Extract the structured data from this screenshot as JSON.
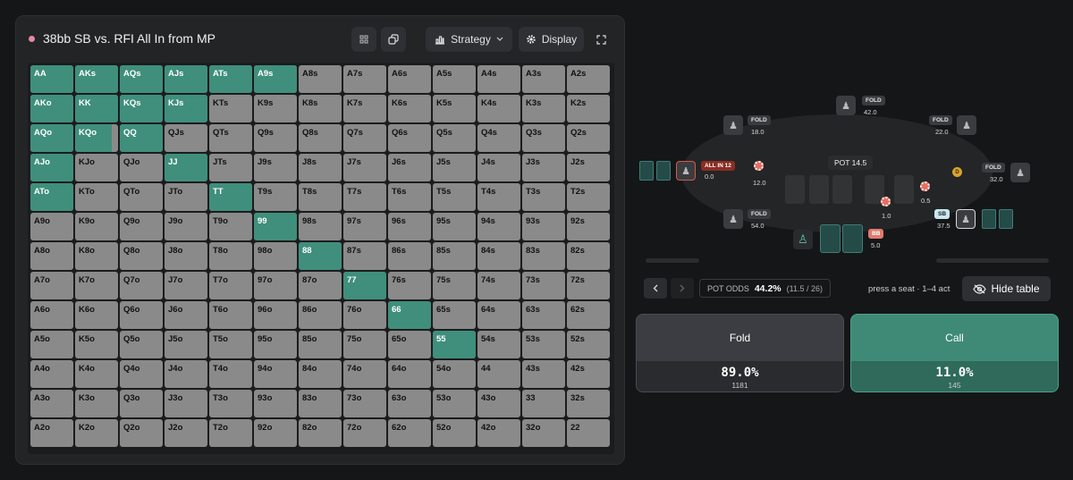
{
  "header": {
    "title": "38bb SB vs. RFI All In from MP",
    "strategy_label": "Strategy",
    "display_label": "Display",
    "status_color": "#e28aa0"
  },
  "colors": {
    "action_call": "#3f8f7c",
    "cell_fold": "#8a8a8a",
    "background": "#151617"
  },
  "range_grid": {
    "hands": [
      [
        "AA",
        "AKs",
        "AQs",
        "AJs",
        "ATs",
        "A9s",
        "A8s",
        "A7s",
        "A6s",
        "A5s",
        "A4s",
        "A3s",
        "A2s"
      ],
      [
        "AKo",
        "KK",
        "KQs",
        "KJs",
        "KTs",
        "K9s",
        "K8s",
        "K7s",
        "K6s",
        "K5s",
        "K4s",
        "K3s",
        "K2s"
      ],
      [
        "AQo",
        "KQo",
        "QQ",
        "QJs",
        "QTs",
        "Q9s",
        "Q8s",
        "Q7s",
        "Q6s",
        "Q5s",
        "Q4s",
        "Q3s",
        "Q2s"
      ],
      [
        "AJo",
        "KJo",
        "QJo",
        "JJ",
        "JTs",
        "J9s",
        "J8s",
        "J7s",
        "J6s",
        "J5s",
        "J4s",
        "J3s",
        "J2s"
      ],
      [
        "ATo",
        "KTo",
        "QTo",
        "JTo",
        "TT",
        "T9s",
        "T8s",
        "T7s",
        "T6s",
        "T5s",
        "T4s",
        "T3s",
        "T2s"
      ],
      [
        "A9o",
        "K9o",
        "Q9o",
        "J9o",
        "T9o",
        "99",
        "98s",
        "97s",
        "96s",
        "95s",
        "94s",
        "93s",
        "92s"
      ],
      [
        "A8o",
        "K8o",
        "Q8o",
        "J8o",
        "T8o",
        "98o",
        "88",
        "87s",
        "86s",
        "85s",
        "84s",
        "83s",
        "82s"
      ],
      [
        "A7o",
        "K7o",
        "Q7o",
        "J7o",
        "T7o",
        "97o",
        "87o",
        "77",
        "76s",
        "75s",
        "74s",
        "73s",
        "72s"
      ],
      [
        "A6o",
        "K6o",
        "Q6o",
        "J6o",
        "T6o",
        "96o",
        "86o",
        "76o",
        "66",
        "65s",
        "64s",
        "63s",
        "62s"
      ],
      [
        "A5o",
        "K5o",
        "Q5o",
        "J5o",
        "T5o",
        "95o",
        "85o",
        "75o",
        "65o",
        "55",
        "54s",
        "53s",
        "52s"
      ],
      [
        "A4o",
        "K4o",
        "Q4o",
        "J4o",
        "T4o",
        "94o",
        "84o",
        "74o",
        "64o",
        "54o",
        "44",
        "43s",
        "42s"
      ],
      [
        "A3o",
        "K3o",
        "Q3o",
        "J3o",
        "T3o",
        "93o",
        "83o",
        "73o",
        "63o",
        "53o",
        "43o",
        "33",
        "32s"
      ],
      [
        "A2o",
        "K2o",
        "Q2o",
        "J2o",
        "T2o",
        "92o",
        "82o",
        "72o",
        "62o",
        "52o",
        "42o",
        "32o",
        "22"
      ]
    ],
    "call_freq": [
      [
        1,
        1,
        1,
        1,
        1,
        1,
        0,
        0,
        0,
        0,
        0,
        0,
        0
      ],
      [
        1,
        1,
        1,
        1,
        0,
        0,
        0,
        0,
        0,
        0,
        0,
        0,
        0
      ],
      [
        1,
        0.85,
        1,
        0,
        0,
        0,
        0,
        0,
        0,
        0,
        0,
        0,
        0
      ],
      [
        1,
        0,
        0,
        1,
        0,
        0,
        0,
        0,
        0,
        0,
        0,
        0,
        0
      ],
      [
        1,
        0,
        0,
        0,
        1,
        0,
        0,
        0,
        0,
        0,
        0,
        0,
        0
      ],
      [
        0,
        0,
        0,
        0,
        0,
        1,
        0,
        0,
        0,
        0,
        0,
        0,
        0
      ],
      [
        0,
        0,
        0,
        0,
        0,
        0,
        1,
        0,
        0,
        0,
        0,
        0,
        0
      ],
      [
        0,
        0,
        0,
        0,
        0,
        0,
        0,
        1,
        0,
        0,
        0,
        0,
        0
      ],
      [
        0,
        0,
        0,
        0,
        0,
        0,
        0,
        0,
        1,
        0,
        0,
        0,
        0
      ],
      [
        0,
        0,
        0,
        0,
        0,
        0,
        0,
        0,
        0,
        1,
        0,
        0,
        0
      ],
      [
        0,
        0,
        0,
        0,
        0,
        0,
        0,
        0,
        0,
        0,
        0,
        0,
        0
      ],
      [
        0,
        0,
        0,
        0,
        0,
        0,
        0,
        0,
        0,
        0,
        0,
        0,
        0
      ],
      [
        0,
        0,
        0,
        0,
        0,
        0,
        0,
        0,
        0,
        0,
        0,
        0,
        0
      ]
    ]
  },
  "table": {
    "pot_label": "POT 14.5",
    "seats": {
      "mp": {
        "badge": "ALL IN 12",
        "stack": "0.0",
        "bet": "12.0"
      },
      "lj": {
        "badge": "FOLD",
        "stack": "18.0"
      },
      "top": {
        "badge": "FOLD",
        "stack": "42.0"
      },
      "co": {
        "badge": "FOLD",
        "stack": "22.0"
      },
      "btn": {
        "badge": "FOLD",
        "stack": "32.0"
      },
      "sb": {
        "badge": "SB",
        "stack": "37.5",
        "bet": "0.5"
      },
      "bb": {
        "badge": "BB",
        "stack": "5.0",
        "bet": "1.0"
      },
      "utg": {
        "badge": "FOLD",
        "stack": "54.0"
      }
    },
    "dealer_label": "D"
  },
  "controls": {
    "prev_icon": "chevron-left-icon",
    "next_icon": "chevron-right-icon",
    "pot_odds_label": "POT ODDS",
    "pot_odds_value": "44.2%",
    "pot_odds_ratio": "(11.5 / 26)",
    "hint": "press a seat · 1–4 act",
    "hide_table_label": "Hide table"
  },
  "actions": [
    {
      "label": "Fold",
      "frequency": "89.0%",
      "combos": "1181"
    },
    {
      "label": "Call",
      "frequency": "11.0%",
      "combos": "145"
    }
  ]
}
